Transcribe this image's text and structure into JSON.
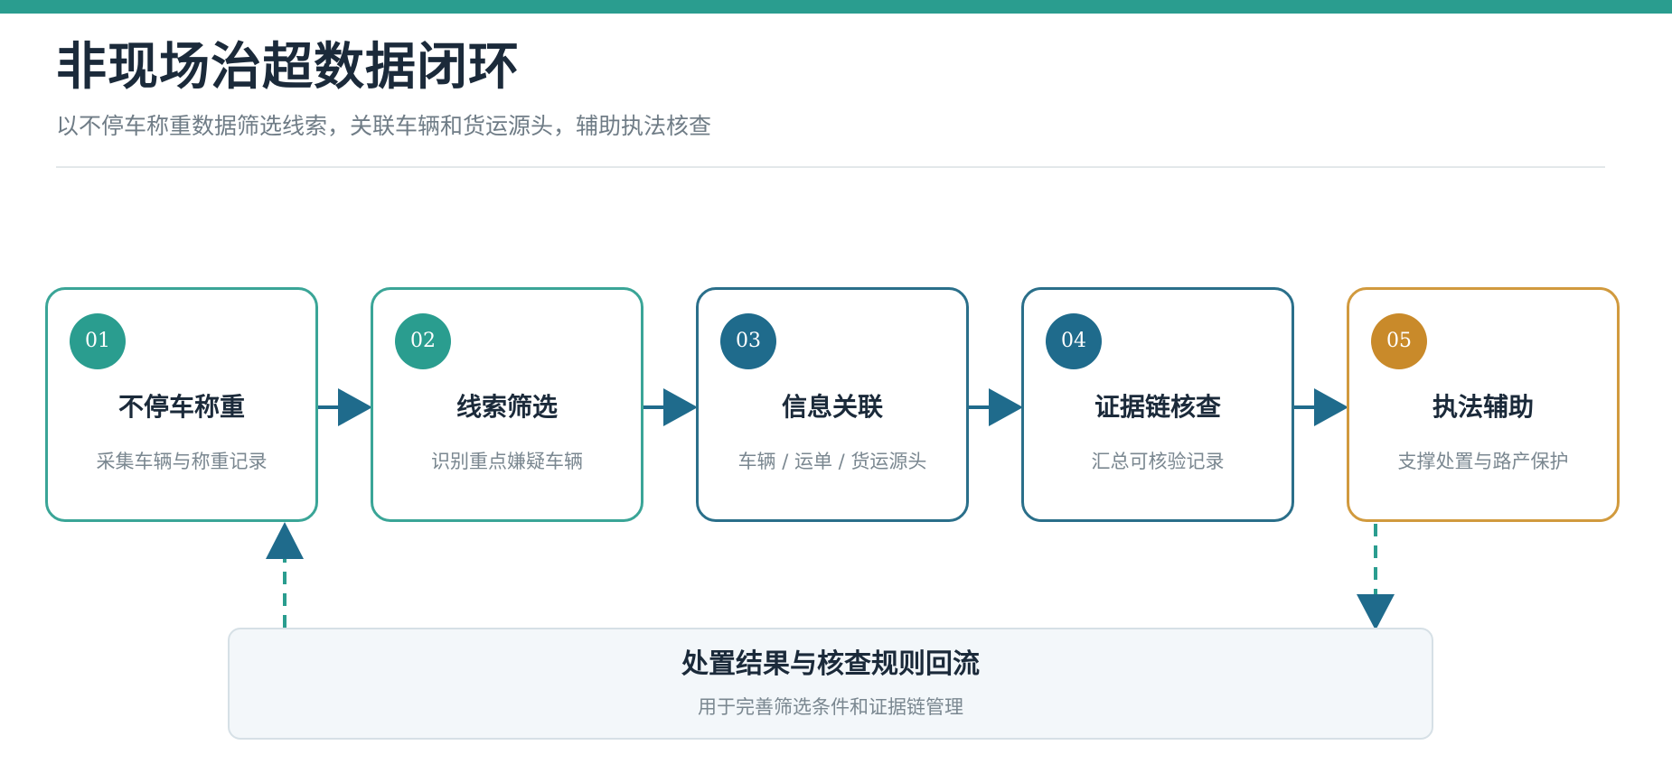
{
  "header": {
    "title": "非现场治超数据闭环",
    "subtitle": "以不停车称重数据筛选线索，关联车辆和货运源头，辅助执法核查"
  },
  "colors": {
    "accent_teal": "#2a9d8f",
    "accent_blue": "#1f6b8c",
    "accent_gold": "#c98a2a",
    "text_dark": "#1b2a3a",
    "text_muted": "#7a8790"
  },
  "steps": [
    {
      "num": "01",
      "title": "不停车称重",
      "desc": "采集车辆与称重记录",
      "color": "#2a9d8f",
      "border": "#3aa597"
    },
    {
      "num": "02",
      "title": "线索筛选",
      "desc": "识别重点嫌疑车辆",
      "color": "#2a9d8f",
      "border": "#3aa597"
    },
    {
      "num": "03",
      "title": "信息关联",
      "desc": "车辆 / 运单 / 货运源头",
      "color": "#1f6b8c",
      "border": "#2a6f8a"
    },
    {
      "num": "04",
      "title": "证据链核查",
      "desc": "汇总可核验记录",
      "color": "#1f6b8c",
      "border": "#2a6f8a"
    },
    {
      "num": "05",
      "title": "执法辅助",
      "desc": "支撑处置与路产保护",
      "color": "#c98a2a",
      "border": "#d19a3e"
    }
  ],
  "feedback": {
    "title": "处置结果与核查规则回流",
    "desc": "用于完善筛选条件和证据链管理"
  }
}
